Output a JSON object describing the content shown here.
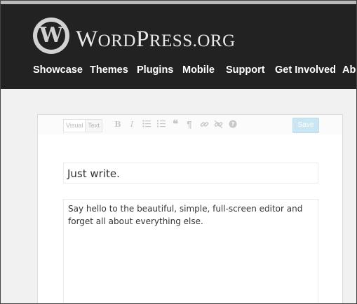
{
  "header": {
    "logo_letter": "W",
    "wordmark": "WordPress.org",
    "nav": [
      "Showcase",
      "Themes",
      "Plugins",
      "Mobile",
      "Support",
      "Get Involved",
      "About"
    ]
  },
  "editor": {
    "tabs": [
      "Visual",
      "Text"
    ],
    "toolbar_icons": [
      "bold-icon",
      "italic-icon",
      "bullet-list-icon",
      "numbered-list-icon",
      "blockquote-icon",
      "paragraph-icon",
      "link-icon",
      "unlink-icon",
      "help-icon"
    ],
    "save_label": "Save",
    "title": "Just write.",
    "body": "Say hello to the beautiful, simple, full-screen editor and forget all about everything else."
  },
  "colors": {
    "header_bg": "#222222",
    "page_bg": "#f1f1f1",
    "save_bg": "#cbe6f3"
  }
}
